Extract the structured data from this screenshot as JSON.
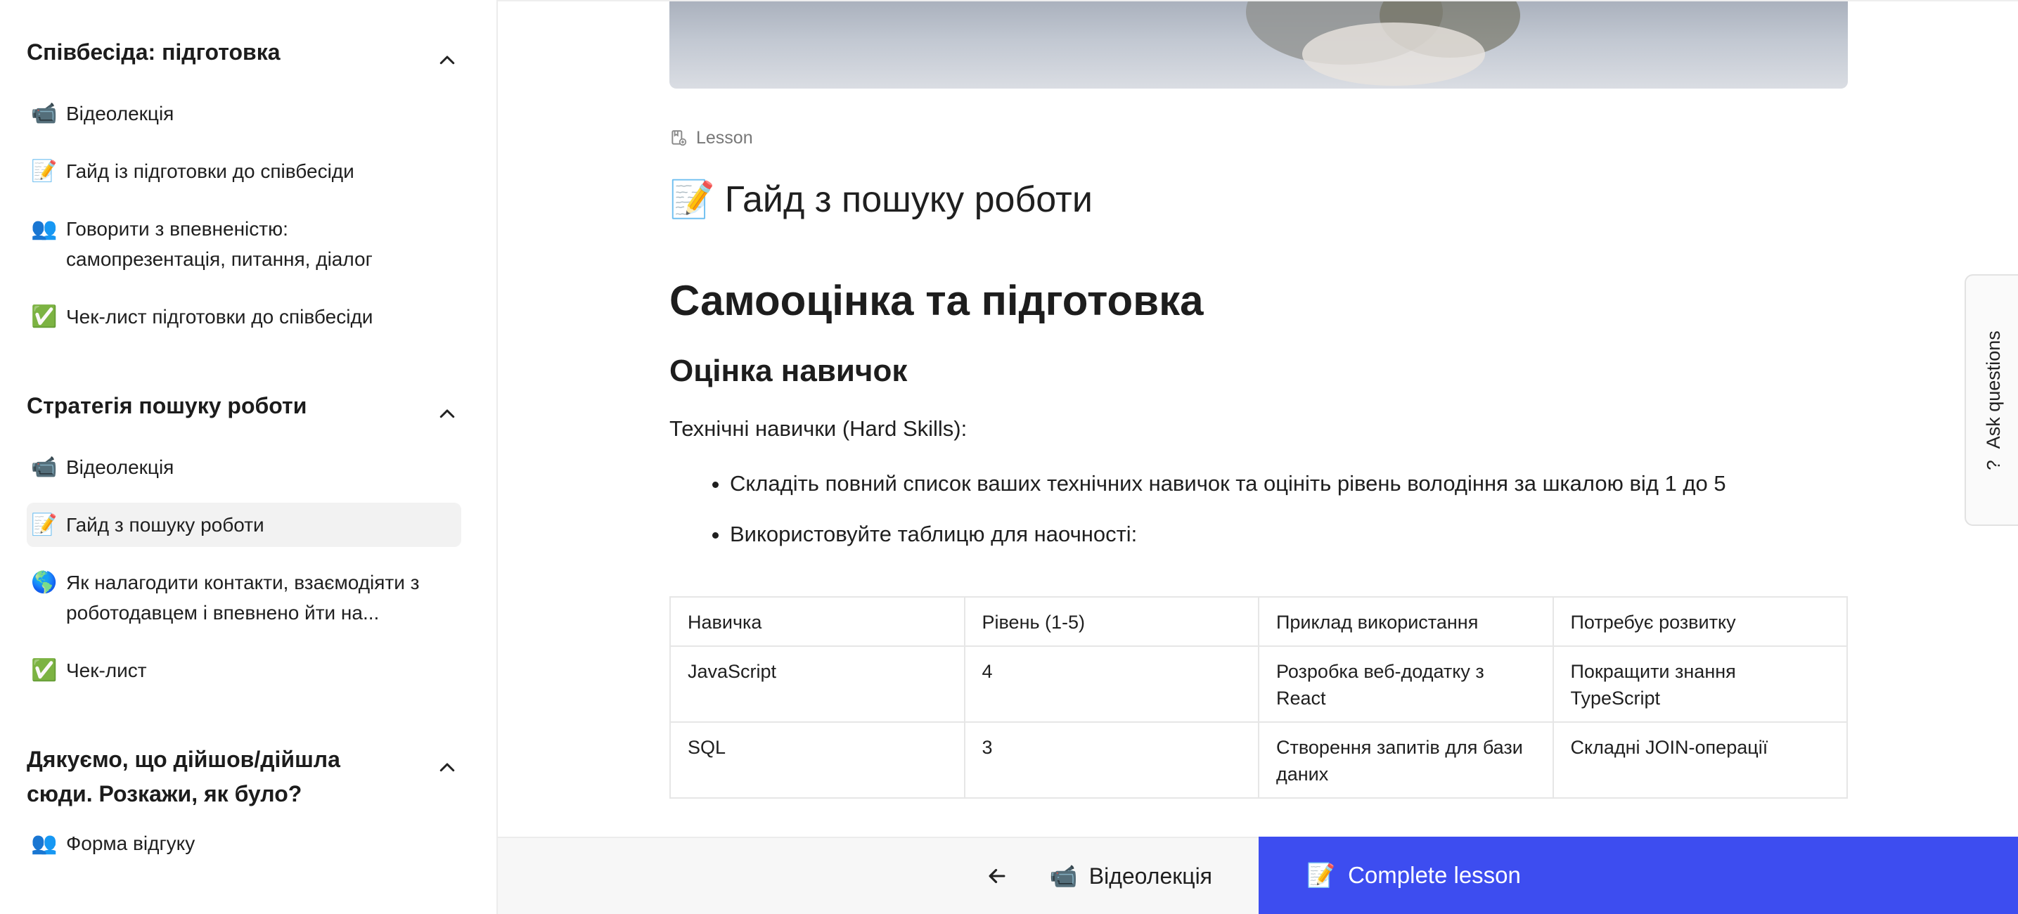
{
  "sidebar": {
    "sections": [
      {
        "title": "Співбесіда: підготовка",
        "items": [
          {
            "icon": "📹",
            "icon_name": "video-camera-icon",
            "label": "Відеолекція"
          },
          {
            "icon": "📝",
            "icon_name": "memo-icon",
            "label": "Гайд із підготовки до співбесіди"
          },
          {
            "icon": "👥",
            "icon_name": "people-icon",
            "label": "Говорити з впевненістю: самопрезентація, питання, діалог"
          },
          {
            "icon": "✅",
            "icon_name": "check-mark-icon",
            "label": "Чек-лист підготовки до співбесіди"
          }
        ]
      },
      {
        "title": "Стратегія пошуку роботи",
        "items": [
          {
            "icon": "📹",
            "icon_name": "video-camera-icon",
            "label": "Відеолекція"
          },
          {
            "icon": "📝",
            "icon_name": "memo-icon",
            "label": "Гайд з пошуку роботи",
            "active": true
          },
          {
            "icon": "🌎",
            "icon_name": "globe-icon",
            "label": "Як налагодити контакти, взаємодіяти з роботодавцем і впевнено йти на..."
          },
          {
            "icon": "✅",
            "icon_name": "check-mark-icon",
            "label": "Чек-лист"
          }
        ]
      },
      {
        "title": "Дякуємо, що дійшов/дійшла сюди. Розкажи, як було?",
        "items": [
          {
            "icon": "👥",
            "icon_name": "people-icon",
            "label": "Форма відгуку"
          }
        ]
      }
    ]
  },
  "lesson": {
    "tag": "Lesson",
    "title_icon": "📝",
    "title": "Гайд з пошуку роботи"
  },
  "article": {
    "h1": "Самооцінка та підготовка",
    "h2": "Оцінка навичок",
    "intro": "Технічні навички (Hard Skills):",
    "bullets": [
      "Складіть повний список ваших технічних навичок та оцініть рівень володіння за шкалою від 1 до 5",
      "Використовуйте таблицю для наочності:"
    ],
    "table": {
      "headers": [
        "Навичка",
        "Рівень (1-5)",
        "Приклад використання",
        "Потребує розвитку"
      ],
      "rows": [
        [
          "JavaScript",
          "4",
          "Розробка веб-додатку з React",
          "Покращити знання TypeScript"
        ],
        [
          "SQL",
          "3",
          "Створення запитів для бази даних",
          "Складні JOIN-операції"
        ]
      ]
    }
  },
  "bottom_nav": {
    "prev_icon": "📹",
    "prev_label": "Відеолекція",
    "complete_icon": "📝",
    "complete_label": "Complete lesson",
    "accent_color": "#3d4df0"
  },
  "ask_tab": {
    "icon": "?",
    "label": "Ask questions"
  }
}
